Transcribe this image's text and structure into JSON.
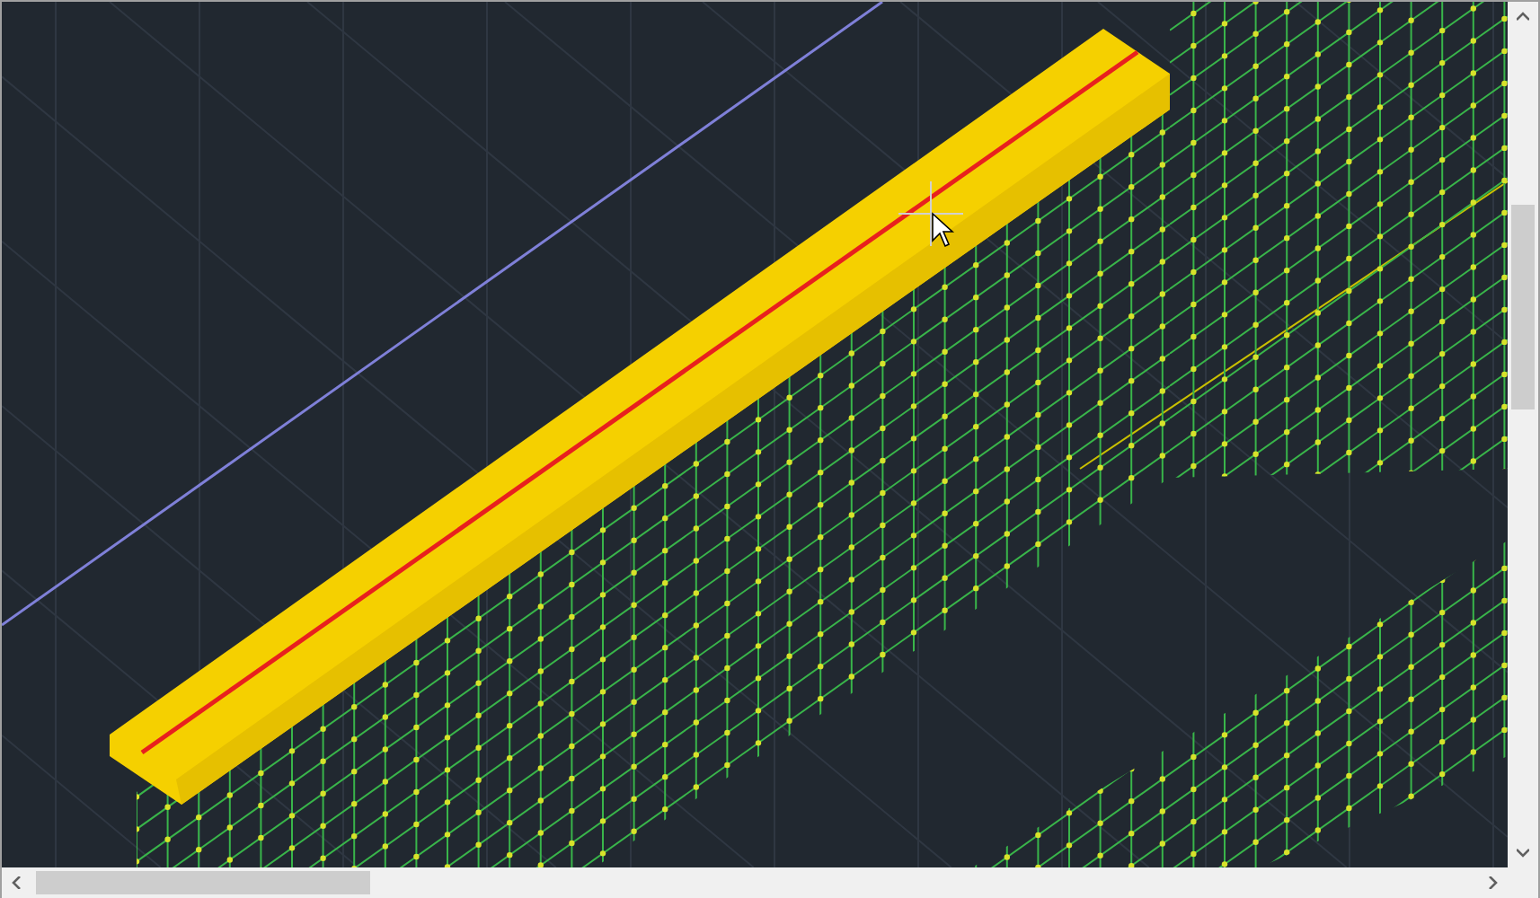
{
  "viewport": {
    "kind": "wireframe"
  },
  "scrollbars": [
    {
      "kind": "vertical"
    },
    {
      "kind": "horizontal"
    }
  ]
}
